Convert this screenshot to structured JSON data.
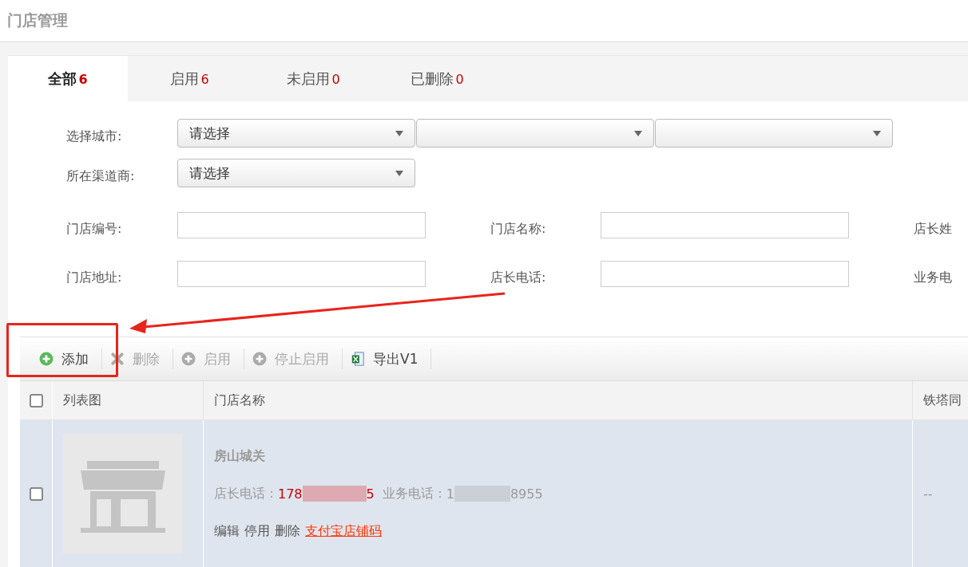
{
  "page_title": "门店管理",
  "tabs": [
    {
      "label": "全部",
      "count": "6",
      "selected": true
    },
    {
      "label": "启用",
      "count": "6",
      "selected": false
    },
    {
      "label": "未启用",
      "count": "0",
      "selected": false
    },
    {
      "label": "已删除",
      "count": "0",
      "selected": false
    }
  ],
  "city_filter": {
    "label": "选择城市:",
    "selects": [
      {
        "kind": "dropdown",
        "value": "请选择"
      },
      {
        "kind": "dropdown"
      },
      {
        "kind": "dropdown"
      }
    ]
  },
  "channel_filter": {
    "label": "所在渠道商:",
    "select": "请选择"
  },
  "fields": [
    {
      "label": "门店编号:"
    },
    {
      "label": "门店名称:"
    },
    {
      "label": "店长姓"
    },
    {
      "label": "门店地址:"
    },
    {
      "label": "店长电话:"
    },
    {
      "label": "业务电"
    }
  ],
  "toolbar": [
    {
      "label": "添加",
      "kind": "add",
      "disabled": false
    },
    {
      "label": "删除",
      "kind": "delete",
      "disabled": true
    },
    {
      "label": "启用",
      "kind": "enable",
      "disabled": true
    },
    {
      "label": "停止启用",
      "kind": "stop",
      "disabled": true
    },
    {
      "label": "导出V1",
      "kind": "excel",
      "disabled": false
    }
  ],
  "table": {
    "header_checked": false,
    "columns": [
      "列表图",
      "门店名称",
      "铁塔同"
    ],
    "rows": [
      {
        "checked": false,
        "name": "房山城关",
        "manager_phone_label": "店长电话：",
        "manager_phone_start": "178",
        "manager_phone_end": "5",
        "business_phone_label": "业务电话：",
        "business_phone_start": "1",
        "business_phone_end": "8955",
        "actions": [
          "编辑",
          "停用",
          "删除"
        ],
        "link": "支付宝店铺码",
        "column_3": "--"
      }
    ]
  },
  "annotation": {
    "highlight": true
  }
}
